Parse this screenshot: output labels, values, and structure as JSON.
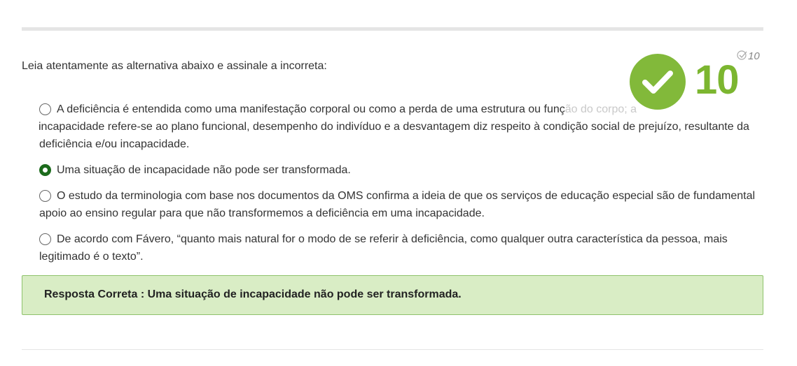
{
  "question": {
    "prompt": "Leia atentamente as alternativa abaixo e assinale a incorreta:"
  },
  "score": {
    "value": "10",
    "max_value": "10",
    "status_color": "#7cb630",
    "status_icon": "check-icon"
  },
  "options": [
    {
      "text_visible": "A deficiência é entendida como uma manifestação corporal ou como a perda de uma estrutura ou funç",
      "text_faded": "ão do corpo; a",
      "text_rest": "incapacidade refere-se ao plano funcional, desempenho do indivíduo e a desvantagem diz respeito à condição social de prejuízo, resultante da deficiência e/ou incapacidade.",
      "selected": false
    },
    {
      "text": "Uma situação de incapacidade não pode ser transformada.",
      "selected": true
    },
    {
      "text": "O estudo da terminologia com base nos documentos da OMS confirma a ideia de que os serviços de educação especial são de fundamental apoio ao ensino regular para que não transformemos a deficiência em uma incapacidade.",
      "selected": false
    },
    {
      "text": "De acordo com Fávero, “quanto mais natural for o modo de se referir à deficiência, como qualquer outra característica da pessoa, mais legitimado é o texto”.",
      "selected": false
    }
  ],
  "answer": {
    "text": "Resposta Correta : Uma situação de incapacidade não pode ser transformada."
  }
}
